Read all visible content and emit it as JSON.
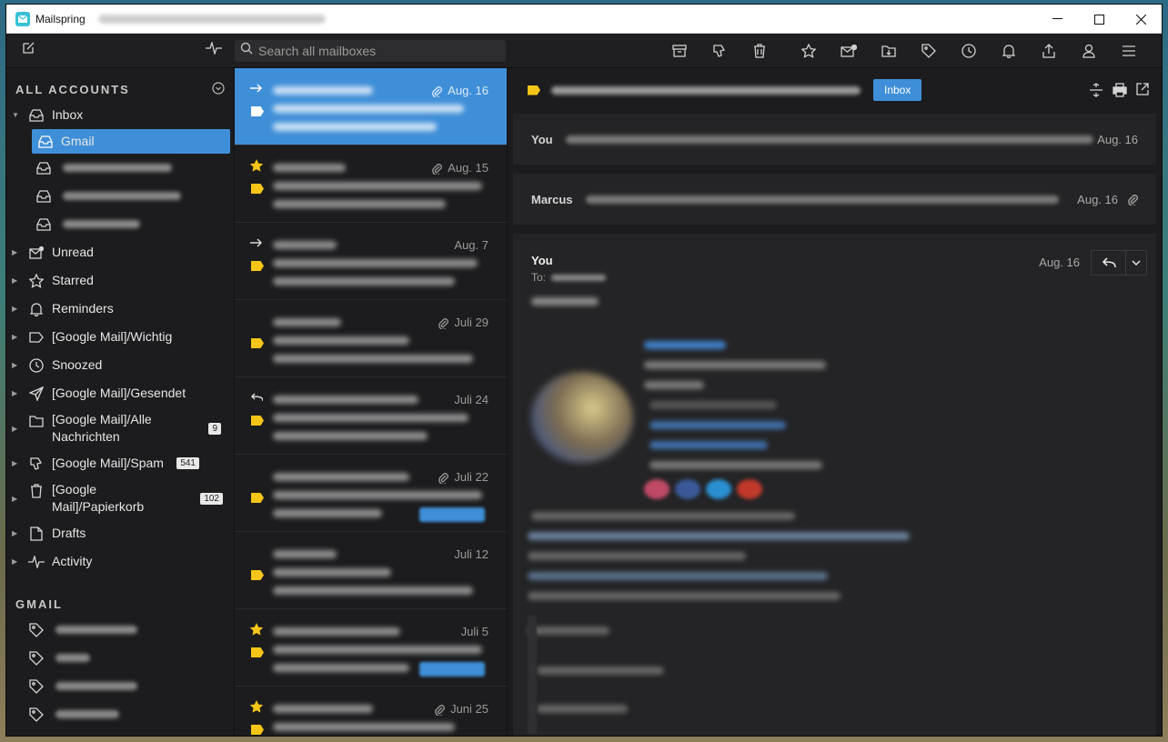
{
  "window": {
    "app_title": "Mailspring"
  },
  "toolbar": {
    "search_placeholder": "Search all mailboxes"
  },
  "sidebar": {
    "all_accounts_heading": "ALL ACCOUNTS",
    "items": [
      {
        "label": "Inbox",
        "icon": "inbox-icon"
      },
      {
        "label": "Gmail",
        "icon": "inbox-icon"
      },
      {
        "label": "Unread",
        "icon": "envelope-dot-icon"
      },
      {
        "label": "Starred",
        "icon": "star-icon"
      },
      {
        "label": "Reminders",
        "icon": "bell-icon"
      },
      {
        "label": "[Google Mail]/Wichtig",
        "icon": "label-icon"
      },
      {
        "label": "Snoozed",
        "icon": "clock-icon"
      },
      {
        "label": "[Google Mail]/Gesendet",
        "icon": "send-icon"
      },
      {
        "label": "[Google Mail]/Alle Nachrichten",
        "icon": "folder-icon",
        "badge": "9"
      },
      {
        "label": "[Google Mail]/Spam",
        "icon": "thumbs-down-icon",
        "badge": "541"
      },
      {
        "label": "[Google Mail]/Papierkorb",
        "icon": "trash-icon",
        "badge": "102"
      },
      {
        "label": "Drafts",
        "icon": "file-icon"
      },
      {
        "label": "Activity",
        "icon": "activity-icon"
      }
    ],
    "gmail_heading": "GMAIL"
  },
  "messages": [
    {
      "date": "Aug. 16",
      "attachment": true,
      "selected": true
    },
    {
      "date": "Aug. 15",
      "attachment": true,
      "starred": true
    },
    {
      "date": "Aug. 7",
      "attachment": false
    },
    {
      "date": "Juli 29",
      "attachment": true
    },
    {
      "date": "Juli 24",
      "attachment": false
    },
    {
      "date": "Juli 22",
      "attachment": true
    },
    {
      "date": "Juli 12",
      "attachment": false
    },
    {
      "date": "Juli 5",
      "attachment": false,
      "starred": true
    },
    {
      "date": "Juni 25",
      "attachment": true,
      "starred": true
    }
  ],
  "reader": {
    "folder_chip": "Inbox",
    "thread": [
      {
        "from": "You",
        "date": "Aug. 16"
      },
      {
        "from": "Marcus",
        "date": "Aug. 16"
      }
    ],
    "open_message": {
      "from": "You",
      "to_label": "To:",
      "date": "Aug. 16"
    }
  },
  "colors": {
    "accent": "#3f8fd8",
    "tag": "#f5c518",
    "background": "#1c1c1e"
  }
}
